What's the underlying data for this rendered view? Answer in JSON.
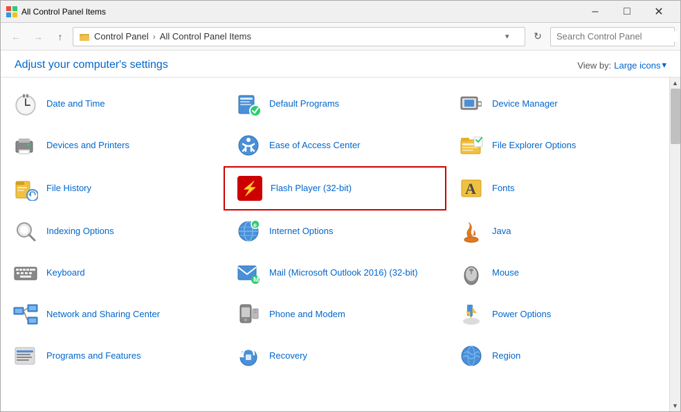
{
  "titleBar": {
    "title": "All Control Panel Items",
    "minLabel": "–",
    "maxLabel": "□",
    "closeLabel": "✕"
  },
  "addressBar": {
    "backDisabled": true,
    "forwardDisabled": true,
    "upLabel": "↑",
    "breadcrumbs": [
      "Control Panel",
      "All Control Panel Items"
    ],
    "searchPlaceholder": "Search Control Panel"
  },
  "header": {
    "title": "Adjust your computer's settings",
    "viewByLabel": "View by:",
    "viewByValue": "Large icons",
    "viewByIcon": "▾"
  },
  "items": [
    {
      "id": "date-time",
      "label": "Date and Time",
      "icon": "clock",
      "highlighted": false,
      "col": 0
    },
    {
      "id": "default-programs",
      "label": "Default Programs",
      "icon": "default",
      "highlighted": false,
      "col": 1
    },
    {
      "id": "device-manager",
      "label": "Device Manager",
      "icon": "device-manager",
      "highlighted": false,
      "col": 2
    },
    {
      "id": "devices-printers",
      "label": "Devices and Printers",
      "icon": "printer",
      "highlighted": false,
      "col": 0
    },
    {
      "id": "ease-of-access",
      "label": "Ease of Access Center",
      "icon": "ease",
      "highlighted": false,
      "col": 1
    },
    {
      "id": "file-explorer",
      "label": "File Explorer Options",
      "icon": "file-explorer",
      "highlighted": false,
      "col": 2
    },
    {
      "id": "file-history",
      "label": "File History",
      "icon": "file-history",
      "highlighted": false,
      "col": 0
    },
    {
      "id": "flash-player",
      "label": "Flash Player (32-bit)",
      "icon": "flash",
      "highlighted": true,
      "col": 1
    },
    {
      "id": "fonts",
      "label": "Fonts",
      "icon": "fonts",
      "highlighted": false,
      "col": 2
    },
    {
      "id": "indexing-options",
      "label": "Indexing Options",
      "icon": "indexing",
      "highlighted": false,
      "col": 0
    },
    {
      "id": "internet-options",
      "label": "Internet Options",
      "icon": "internet",
      "highlighted": false,
      "col": 1
    },
    {
      "id": "java",
      "label": "Java",
      "icon": "java",
      "highlighted": false,
      "col": 2
    },
    {
      "id": "keyboard",
      "label": "Keyboard",
      "icon": "keyboard",
      "highlighted": false,
      "col": 0
    },
    {
      "id": "mail",
      "label": "Mail (Microsoft Outlook 2016) (32-bit)",
      "icon": "mail",
      "highlighted": false,
      "col": 1
    },
    {
      "id": "mouse",
      "label": "Mouse",
      "icon": "mouse",
      "highlighted": false,
      "col": 2
    },
    {
      "id": "network-sharing",
      "label": "Network and Sharing Center",
      "icon": "network",
      "highlighted": false,
      "col": 0
    },
    {
      "id": "phone-modem",
      "label": "Phone and Modem",
      "icon": "phone",
      "highlighted": false,
      "col": 1
    },
    {
      "id": "power-options",
      "label": "Power Options",
      "icon": "power",
      "highlighted": false,
      "col": 2
    },
    {
      "id": "programs-features",
      "label": "Programs and Features",
      "icon": "programs",
      "highlighted": false,
      "col": 0
    },
    {
      "id": "recovery",
      "label": "Recovery",
      "icon": "recovery",
      "highlighted": false,
      "col": 1
    },
    {
      "id": "region",
      "label": "Region",
      "icon": "region",
      "highlighted": false,
      "col": 2
    }
  ]
}
